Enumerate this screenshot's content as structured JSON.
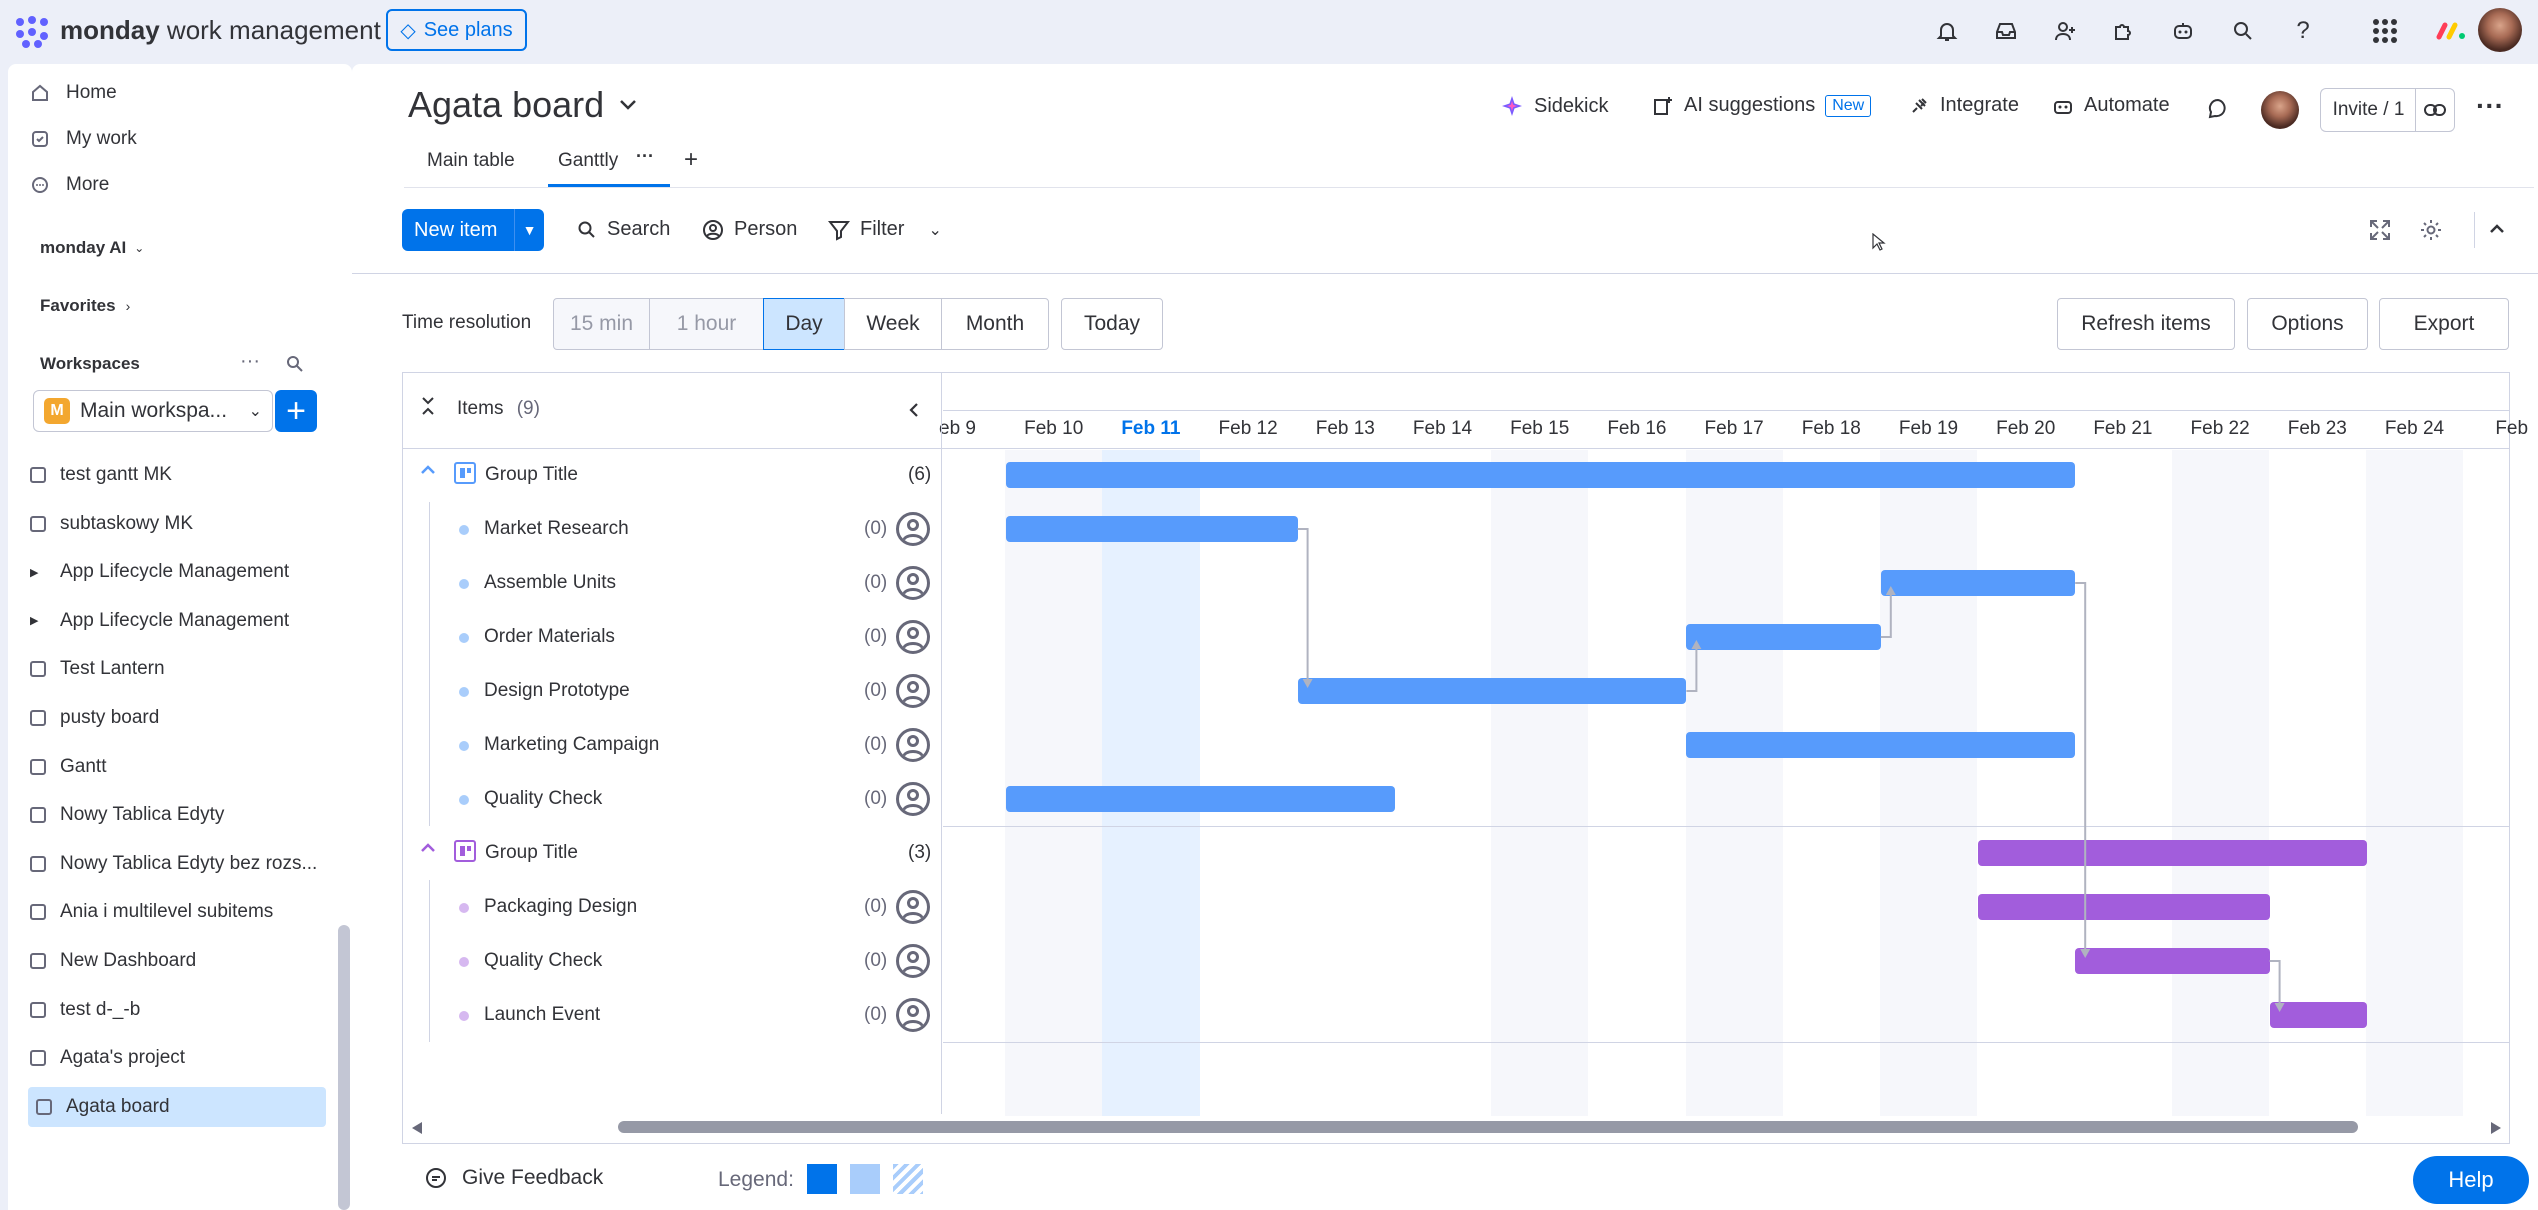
{
  "app": {
    "logo_bold": "monday",
    "logo_rest": " work management",
    "see_plans": "See plans"
  },
  "sidebar": {
    "nav": [
      {
        "label": "Home",
        "icon": "home-icon"
      },
      {
        "label": "My work",
        "icon": "my-work-icon"
      },
      {
        "label": "More",
        "icon": "more-icon"
      }
    ],
    "monday_ai": "monday AI",
    "favorites": "Favorites",
    "workspaces": "Workspaces",
    "workspace_name": "Main workspa...",
    "workspace_initial": "M",
    "boards": [
      {
        "label": "test gantt MK"
      },
      {
        "label": "subtaskowy MK"
      },
      {
        "label": "App Lifecycle Management"
      },
      {
        "label": "App Lifecycle Management"
      },
      {
        "label": "Test Lantern"
      },
      {
        "label": "pusty board"
      },
      {
        "label": "Gantt"
      },
      {
        "label": "Nowy Tablica Edyty"
      },
      {
        "label": "Nowy Tablica Edyty bez rozs..."
      },
      {
        "label": "Ania i multilevel subitems"
      },
      {
        "label": "New Dashboard"
      },
      {
        "label": "test d-_-b"
      },
      {
        "label": "Agata's project"
      },
      {
        "label": "Agata board"
      }
    ]
  },
  "board": {
    "title": "Agata board",
    "actions": {
      "sidekick": "Sidekick",
      "ai_suggestions": "AI suggestions",
      "new_badge": "New",
      "integrate": "Integrate",
      "automate": "Automate",
      "invite": "Invite / 1"
    },
    "tabs": [
      {
        "label": "Main table"
      },
      {
        "label": "Ganttly"
      }
    ],
    "toolbar": {
      "new_item": "New item",
      "search": "Search",
      "person": "Person",
      "filter": "Filter"
    }
  },
  "gantt": {
    "time_resolution_label": "Time resolution",
    "resolutions": [
      "15 min",
      "1 hour",
      "Day",
      "Week",
      "Month"
    ],
    "selected_resolution": "Day",
    "today": "Today",
    "refresh": "Refresh items",
    "options": "Options",
    "export": "Export",
    "items_label": "Items",
    "items_count": "(9)",
    "dates": [
      "eb 9",
      "Feb 10",
      "Feb 11",
      "Feb 12",
      "Feb 13",
      "Feb 14",
      "Feb 15",
      "Feb 16",
      "Feb 17",
      "Feb 18",
      "Feb 19",
      "Feb 20",
      "Feb 21",
      "Feb 22",
      "Feb 23",
      "Feb 24",
      "Feb"
    ],
    "today_date": "Feb 11",
    "groups": [
      {
        "title": "Group Title",
        "count": "(6)",
        "color": "#579bfc",
        "items": [
          {
            "name": "Market Research",
            "count": "(0)"
          },
          {
            "name": "Assemble Units",
            "count": "(0)"
          },
          {
            "name": "Order Materials",
            "count": "(0)"
          },
          {
            "name": "Design Prototype",
            "count": "(0)"
          },
          {
            "name": "Marketing Campaign",
            "count": "(0)"
          },
          {
            "name": "Quality Check",
            "count": "(0)"
          }
        ]
      },
      {
        "title": "Group Title",
        "count": "(3)",
        "color": "#a25ddc",
        "items": [
          {
            "name": "Packaging Design",
            "count": "(0)"
          },
          {
            "name": "Quality Check",
            "count": "(0)"
          },
          {
            "name": "Launch Event",
            "count": "(0)"
          }
        ]
      }
    ],
    "feedback": "Give Feedback",
    "legend": "Legend:"
  },
  "help": "Help"
}
